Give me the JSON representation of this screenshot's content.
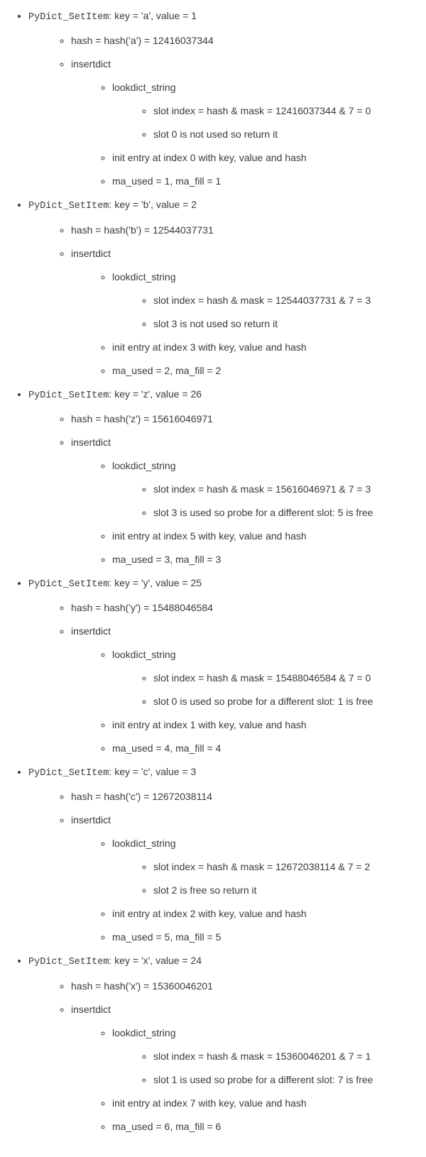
{
  "entries": [
    {
      "title_prefix": "PyDict_SetItem",
      "title_rest": ": key = 'a', value = 1",
      "hash_line": "hash = hash('a') = 12416037344",
      "lookdict": "lookdict_string",
      "slot_index": "slot index = hash & mask = 12416037344 & 7 = 0",
      "slot_status": "slot 0 is not used so return it",
      "init_entry": "init entry at index 0 with key, value and hash",
      "ma_line": "ma_used = 1, ma_fill = 1"
    },
    {
      "title_prefix": "PyDict_SetItem",
      "title_rest": ": key = 'b', value = 2",
      "hash_line": "hash = hash('b') = 12544037731",
      "lookdict": "lookdict_string",
      "slot_index": "slot index = hash & mask = 12544037731 & 7 = 3",
      "slot_status": "slot 3 is not used so return it",
      "init_entry": "init entry at index 3 with key, value and hash",
      "ma_line": "ma_used = 2, ma_fill = 2"
    },
    {
      "title_prefix": "PyDict_SetItem",
      "title_rest": ": key = 'z', value = 26",
      "hash_line": "hash = hash('z') = 15616046971",
      "lookdict": "lookdict_string",
      "slot_index": "slot index = hash & mask = 15616046971 & 7 = 3",
      "slot_status": "slot 3 is used so probe for a different slot: 5 is free",
      "init_entry": "init entry at index 5 with key, value and hash",
      "ma_line": "ma_used = 3, ma_fill = 3"
    },
    {
      "title_prefix": "PyDict_SetItem",
      "title_rest": ": key = 'y', value = 25",
      "hash_line": "hash = hash('y') = 15488046584",
      "lookdict": "lookdict_string",
      "slot_index": "slot index = hash & mask = 15488046584 & 7 = 0",
      "slot_status": "slot 0 is used so probe for a different slot: 1 is free",
      "init_entry": "init entry at index 1 with key, value and hash",
      "ma_line": "ma_used = 4, ma_fill = 4"
    },
    {
      "title_prefix": "PyDict_SetItem",
      "title_rest": ": key = 'c', value = 3",
      "hash_line": "hash = hash('c') = 12672038114",
      "lookdict": "lookdict_string",
      "slot_index": "slot index = hash & mask = 12672038114 & 7 = 2",
      "slot_status": "slot 2 is free so return it",
      "init_entry": "init entry at index 2 with key, value and hash",
      "ma_line": "ma_used = 5, ma_fill = 5"
    },
    {
      "title_prefix": "PyDict_SetItem",
      "title_rest": ": key = 'x', value = 24",
      "hash_line": "hash = hash('x') = 15360046201",
      "lookdict": "lookdict_string",
      "slot_index": "slot index = hash & mask = 15360046201 & 7 = 1",
      "slot_status": "slot 1 is used so probe for a different slot: 7 is free",
      "init_entry": "init entry at index 7 with key, value and hash",
      "ma_line": "ma_used = 6, ma_fill = 6"
    }
  ],
  "insertdict_label": "insertdict"
}
